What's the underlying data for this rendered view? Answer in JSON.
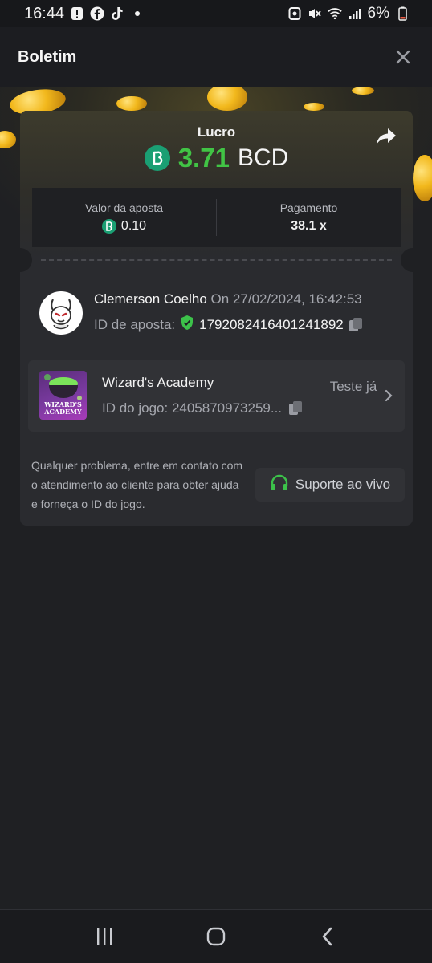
{
  "status_bar": {
    "time": "16:44",
    "battery_percent": "6%",
    "icons_left": [
      "alert-icon",
      "facebook-icon",
      "tiktok-icon",
      "dot-icon"
    ],
    "icons_right": [
      "screenshot-icon",
      "mute-icon",
      "wifi-icon",
      "signal-icon",
      "battery-icon"
    ]
  },
  "header": {
    "title": "Boletim",
    "close_icon": "close-icon"
  },
  "bet": {
    "profit_label": "Lucro",
    "profit_value": "3.71",
    "profit_currency": "BCD",
    "share_icon": "share-icon",
    "stake_label": "Valor da aposta",
    "stake_value": "0.10",
    "payout_label": "Pagamento",
    "payout_value": "38.1 x"
  },
  "user": {
    "name": "Clemerson Coelho",
    "date": "On 27/02/2024, 16:42:53",
    "bet_id_label": "ID de aposta:",
    "bet_id": "1792082416401241892"
  },
  "game": {
    "name": "Wizard's Academy",
    "id_line": "ID do jogo: 2405870973259...",
    "try_label": "Teste já",
    "thumb_text": "WIZARD'S ACADEMY"
  },
  "help": {
    "text": "Qualquer problema, entre em contato com o atendimento ao cliente para obter ajuda e forneça o ID do jogo.",
    "support_label": "Suporte ao vivo"
  },
  "colors": {
    "profit_green": "#41c445",
    "bcd_badge": "#1a9f73",
    "verified_green": "#3cc24a",
    "background": "#1f2023",
    "card": "#2a2b2f"
  },
  "navbar": {
    "icons": [
      "recent-apps-icon",
      "home-icon",
      "back-icon"
    ]
  }
}
